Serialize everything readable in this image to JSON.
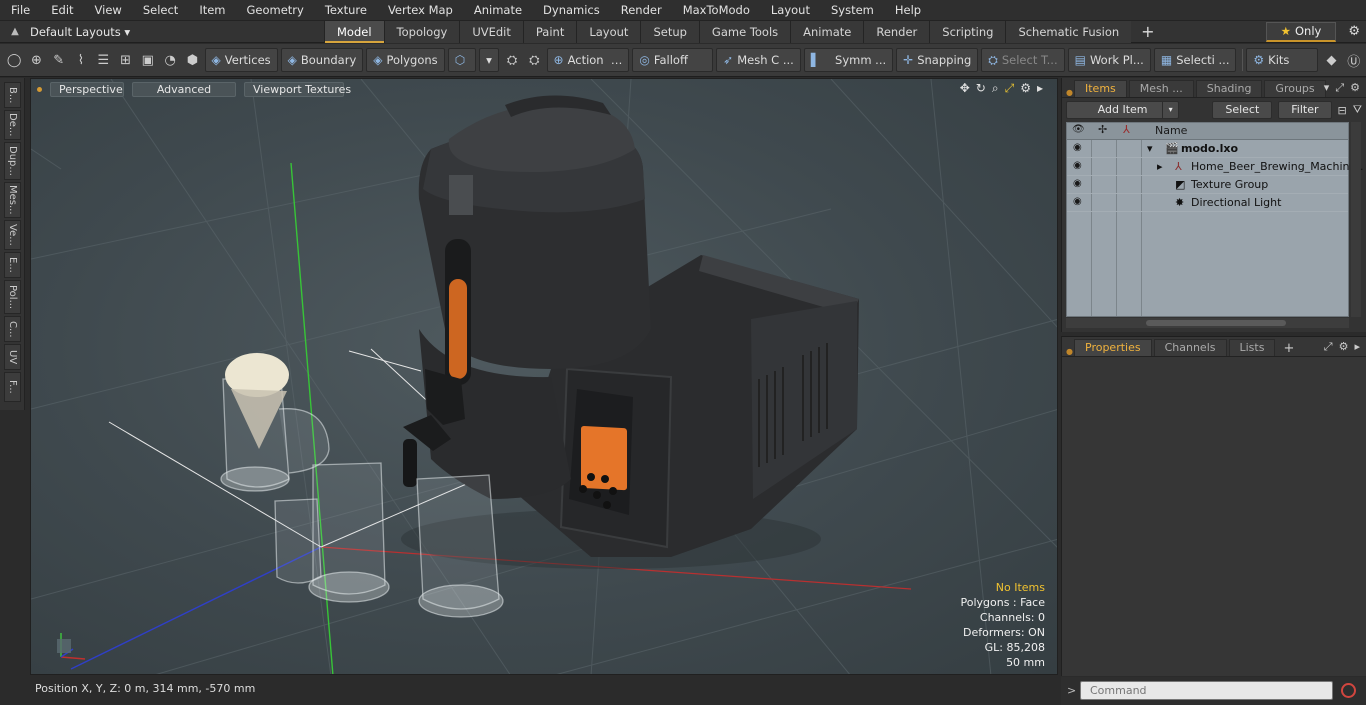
{
  "menu": [
    "File",
    "Edit",
    "View",
    "Select",
    "Item",
    "Geometry",
    "Texture",
    "Vertex Map",
    "Animate",
    "Dynamics",
    "Render",
    "MaxToModo",
    "Layout",
    "System",
    "Help"
  ],
  "layout_selector": "Default Layouts",
  "layout_tabs": [
    "Model",
    "Topology",
    "UVEdit",
    "Paint",
    "Layout",
    "Setup",
    "Game Tools",
    "Animate",
    "Render",
    "Scripting",
    "Schematic Fusion"
  ],
  "active_layout_tab": "Model",
  "only_button": "Only",
  "toolbar": {
    "vertices": "Vertices",
    "boundary": "Boundary",
    "polygons": "Polygons",
    "action": "Action",
    "falloff": "Falloff",
    "mesh": "Mesh C ...",
    "symmetry": "Symm ...",
    "snapping": "Snapping",
    "select_t": "Select T...",
    "workplane": "Work Pl...",
    "selection": "Selecti ...",
    "kits": "Kits"
  },
  "left_tabs": [
    "B...",
    "De...",
    "Dup...",
    "Mes...",
    "Ve...",
    "E...",
    "Pol...",
    "C...",
    "UV",
    "F..."
  ],
  "viewport": {
    "perspective": "Perspective",
    "advanced": "Advanced",
    "textures": "Viewport Textures",
    "stats": {
      "no_items": "No Items",
      "polygons": "Polygons : Face",
      "channels": "Channels: 0",
      "deformers": "Deformers: ON",
      "gl": "GL: 85,208",
      "size": "50 mm"
    }
  },
  "status_bar": "Position X, Y, Z:   0 m, 314 mm, -570 mm",
  "items_panel": {
    "tabs": [
      "Items",
      "Mesh ...",
      "Shading",
      "Groups"
    ],
    "add_item": "Add Item",
    "select": "Select",
    "filter": "Filter",
    "column_name": "Name",
    "tree": [
      {
        "label": "modo.lxo"
      },
      {
        "label": "Home_Beer_Brewing_Machin ..."
      },
      {
        "label": "Texture Group"
      },
      {
        "label": "Directional Light"
      }
    ]
  },
  "properties_panel": {
    "tabs": [
      "Properties",
      "Channels",
      "Lists"
    ]
  },
  "command_placeholder": "Command",
  "colors": {
    "accent": "#d7a53d",
    "viewport_bg": "#455055",
    "axis_x": "#c0302e",
    "axis_y": "#3fbf3f",
    "axis_z": "#3040c8",
    "machine_body": "#2c2d2f",
    "display_orange": "#f07a2a"
  }
}
